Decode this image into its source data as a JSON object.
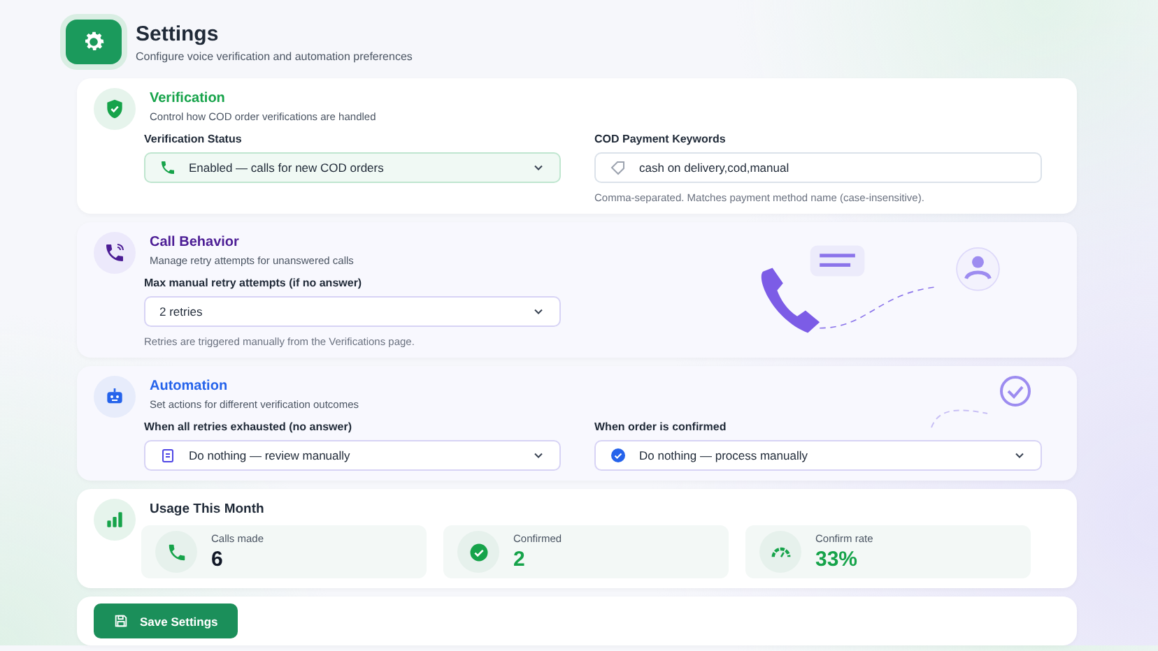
{
  "header": {
    "title": "Settings",
    "subtitle": "Configure voice verification and automation preferences"
  },
  "sections": [
    {
      "kind": "verification",
      "title": "Verification",
      "subtitle": "Control how COD order verifications are handled",
      "fields": [
        {
          "kind": "select",
          "label": "Verification Status",
          "value": "Enabled — calls for new COD orders"
        },
        {
          "kind": "text",
          "label": "COD Payment Keywords",
          "value": "cash on delivery,cod,manual",
          "hint": "Comma-separated. Matches payment method name (case-insensitive)."
        }
      ]
    },
    {
      "kind": "calls",
      "title": "Call Behavior",
      "subtitle": "Manage retry attempts for unanswered calls",
      "fields": [
        {
          "kind": "select",
          "label": "Max manual retry attempts (if no answer)",
          "value": "2 retries",
          "hint": "Retries are triggered manually from the Verifications page."
        }
      ]
    },
    {
      "kind": "automation",
      "title": "Automation",
      "subtitle": "Set actions for different verification outcomes",
      "fields": [
        {
          "kind": "select",
          "label": "When all retries exhausted (no answer)",
          "value": "Do nothing — review manually"
        },
        {
          "kind": "select",
          "label": "When order is confirmed",
          "value": "Do nothing — process manually"
        }
      ]
    }
  ],
  "usage": {
    "title": "Usage This Month",
    "stats": [
      {
        "kind": "calls",
        "label": "Calls made",
        "value": "6"
      },
      {
        "kind": "confirmed",
        "label": "Confirmed",
        "value": "2"
      },
      {
        "kind": "rate",
        "label": "Confirm rate",
        "value": "33%"
      }
    ]
  },
  "save_button": "Save Settings"
}
